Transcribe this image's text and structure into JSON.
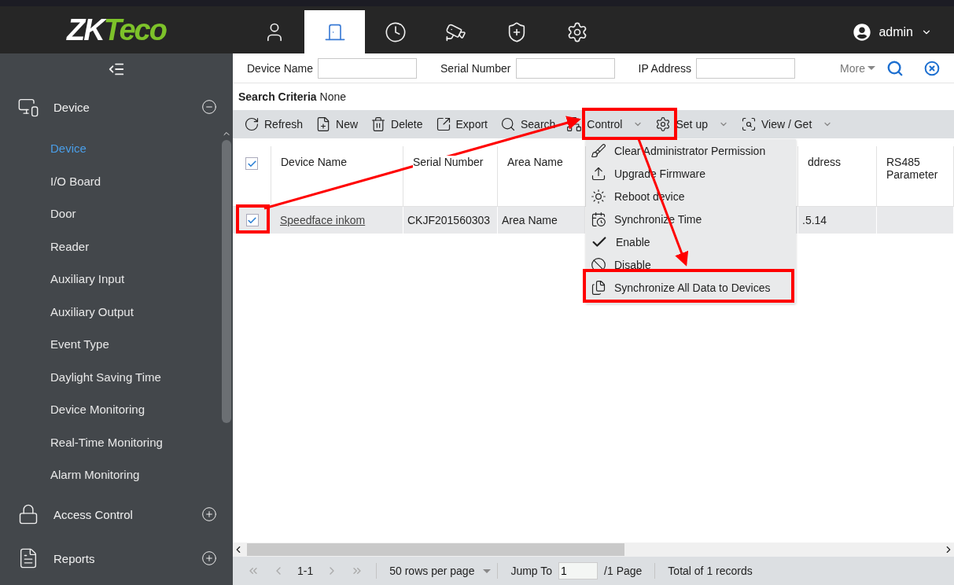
{
  "header": {
    "logo": {
      "main": "ZK",
      "accent": "Teco"
    },
    "tabs": [
      {
        "kind": "person",
        "selected": false
      },
      {
        "kind": "door",
        "selected": true
      },
      {
        "kind": "clock",
        "selected": false
      },
      {
        "kind": "camera",
        "selected": false
      },
      {
        "kind": "shield",
        "selected": false
      },
      {
        "kind": "gear",
        "selected": false
      }
    ],
    "user": "admin"
  },
  "sidebar": {
    "groups": [
      {
        "label": "Device",
        "kind": "device",
        "expanded": true,
        "children": [
          {
            "label": "Device",
            "selected": true
          },
          {
            "label": "I/O Board",
            "selected": false
          },
          {
            "label": "Door",
            "selected": false
          },
          {
            "label": "Reader",
            "selected": false
          },
          {
            "label": "Auxiliary Input",
            "selected": false
          },
          {
            "label": "Auxiliary Output",
            "selected": false
          },
          {
            "label": "Event Type",
            "selected": false
          },
          {
            "label": "Daylight Saving Time",
            "selected": false
          },
          {
            "label": "Device Monitoring",
            "selected": false
          },
          {
            "label": "Real-Time Monitoring",
            "selected": false
          },
          {
            "label": "Alarm Monitoring",
            "selected": false
          }
        ]
      },
      {
        "label": "Access Control",
        "kind": "lock",
        "expanded": false
      },
      {
        "label": "Reports",
        "kind": "report",
        "expanded": false
      }
    ]
  },
  "search": {
    "fields": [
      {
        "label": "Device Name"
      },
      {
        "label": "Serial Number"
      },
      {
        "label": "IP Address"
      }
    ],
    "more": "More"
  },
  "criteria": {
    "label": "Search Criteria",
    "value": "None"
  },
  "toolbar": [
    {
      "label": "Refresh",
      "kind": "refresh",
      "dropdown": false
    },
    {
      "label": "New",
      "kind": "new",
      "dropdown": false
    },
    {
      "label": "Delete",
      "kind": "delete",
      "dropdown": false
    },
    {
      "label": "Export",
      "kind": "export",
      "dropdown": false
    },
    {
      "label": "Search",
      "kind": "search",
      "dropdown": false
    },
    {
      "label": "Control",
      "kind": "control",
      "dropdown": true
    },
    {
      "label": "Set up",
      "kind": "setup",
      "dropdown": true
    },
    {
      "label": "View / Get",
      "kind": "view",
      "dropdown": true
    }
  ],
  "menu": [
    {
      "label": "Clear Administrator Permission",
      "kind": "broom"
    },
    {
      "label": "Upgrade Firmware",
      "kind": "upload"
    },
    {
      "label": "Reboot device",
      "kind": "reboot"
    },
    {
      "label": "Synchronize Time",
      "kind": "time"
    },
    {
      "label": "Enable",
      "kind": "check"
    },
    {
      "label": "Disable",
      "kind": "ban"
    },
    {
      "label": "Synchronize All Data to Devices",
      "kind": "sync"
    }
  ],
  "table": {
    "all_checked": true,
    "columns": [
      {
        "label": "Device Name"
      },
      {
        "label": "Serial Number"
      },
      {
        "label": "Area Name"
      },
      {},
      {
        "label": "ddress"
      },
      {
        "label": "RS485 Parameter"
      }
    ],
    "rows": [
      {
        "checked": true,
        "cells": [
          "Speedface inkom",
          "CKJF201560303",
          "Area Name",
          null,
          ".5.14",
          null
        ]
      }
    ]
  },
  "pager": {
    "range": "1-1",
    "rows_per_page": "50 rows per page",
    "jump_label": "Jump To",
    "page_value": "1",
    "pages": "/1 Page",
    "total": "Total of 1 records"
  }
}
